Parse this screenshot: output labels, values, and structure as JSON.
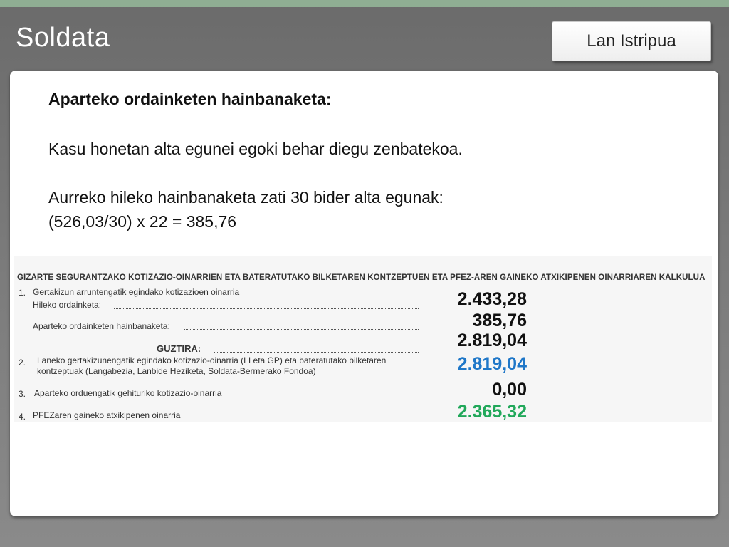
{
  "slide": {
    "title": "Soldata",
    "tab_label": "Lan Istripua"
  },
  "content": {
    "heading": "Aparteko ordainketen hainbanaketa:",
    "para1": "Kasu honetan alta egunei egoki behar diegu zenbatekoa.",
    "para2": "Aurreko hileko hainbanaketa zati 30 bider alta egunak:",
    "para3": "(526,03/30) x 22 = 385,76"
  },
  "form": {
    "header": "GIZARTE SEGURANTZAKO KOTIZAZIO-OINARRIEN ETA BATERATUTAKO BILKETAREN KONTZEPTUEN ETA PFEZ-AREN GAINEKO ATXIKIPENEN OINARRIAREN KALKULUA",
    "row1_num": "1.",
    "row1_label": "Gertakizun arruntengatik egindako kotizazioen oinarria",
    "row1a_label": "Hileko ordainketa:",
    "row1b_label": "Aparteko ordainketen hainbanaketa:",
    "guztira_label": "GUZTIRA:",
    "row2_num": "2.",
    "row2_label_line1": "Laneko gertakizunengatik egindako kotizazio-oinarria (LI eta GP) eta bateratutako bilketaren",
    "row2_label_line2": "kontzeptuak (Langabezia, Lanbide Heziketa, Soldata-Bermerako Fondoa)",
    "row3_num": "3.",
    "row3_label": "Aparteko orduengatik gehituriko kotizazio-oinarria",
    "row4_num": "4.",
    "row4_label": "PFEZaren gaineko atxikipenen oinarria"
  },
  "amounts": {
    "hileko_ordainketa": "2.433,28",
    "aparteko_hainbanaketa": "385,76",
    "guztira": "2.819,04",
    "laneko_oinarria": "2.819,04",
    "aparteko_orduak": "0,00",
    "pfez_oinarria": "2.365,32"
  },
  "colors": {
    "blue_value": "#1f77c8",
    "green_value": "#21a85a",
    "top_strip": "#8fae93"
  }
}
